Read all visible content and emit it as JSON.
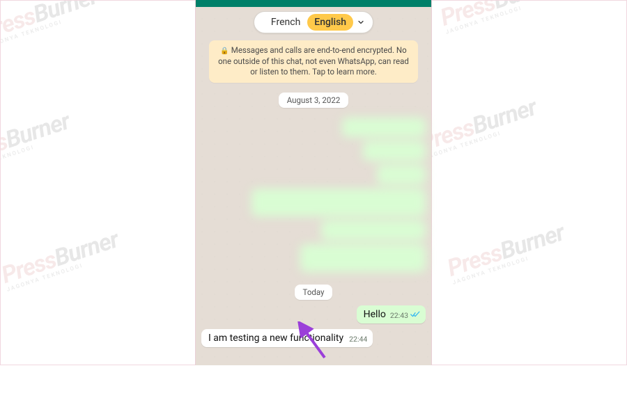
{
  "watermark": {
    "brand_left": "Press",
    "brand_right": "Burner",
    "tagline": "JAGONYA TEKNOLOGI"
  },
  "header": {
    "accent_color": "#008069"
  },
  "language_switch": {
    "option_a": "French",
    "option_b": "English",
    "active": "English"
  },
  "encryption_notice": {
    "icon": "lock-icon",
    "text": "Messages and calls are end-to-end encrypted. No one outside of this chat, not even WhatsApp, can read or listen to them. Tap to learn more."
  },
  "dates": {
    "d1": "August 3, 2022",
    "d2": "Today"
  },
  "messages": {
    "out1": {
      "text": "Hello",
      "time": "22:43",
      "status": "read"
    },
    "in1": {
      "text": "I am testing a new functionality",
      "time": "22:44"
    }
  },
  "annotation": {
    "arrow_color": "#9b3fd9"
  }
}
